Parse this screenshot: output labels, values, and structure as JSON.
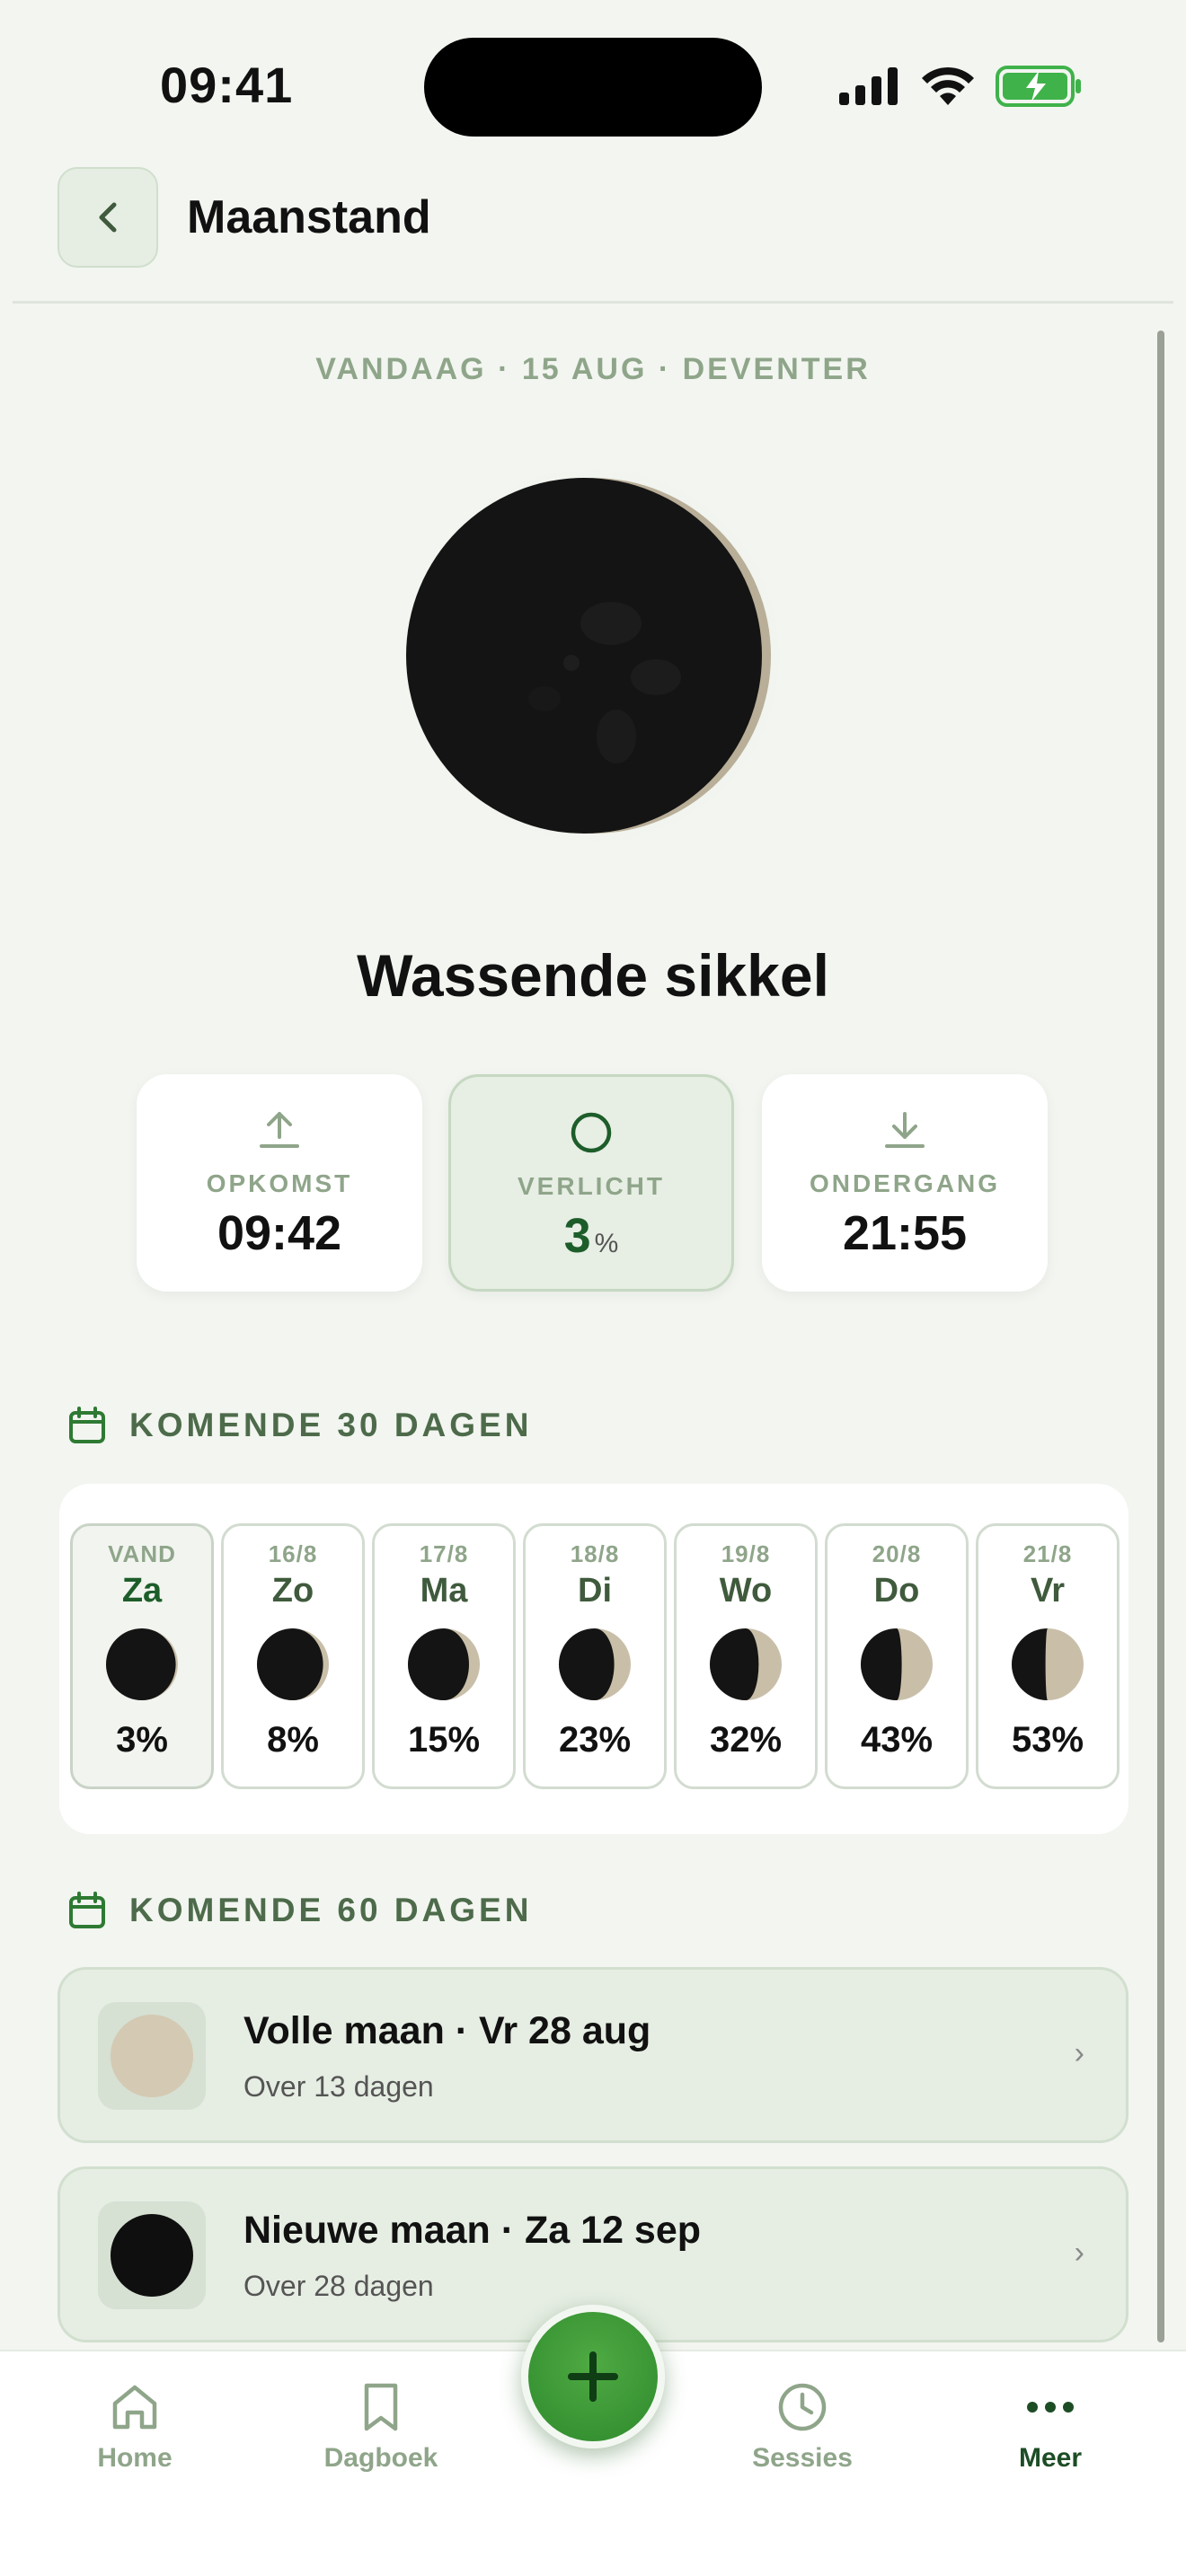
{
  "status_bar": {
    "time": "09:41"
  },
  "header": {
    "title": "Maanstand"
  },
  "today": {
    "date_line": "VANDAAG · 15 AUG · DEVENTER",
    "phase_name": "Wassende sikkel",
    "illumination": 0.03
  },
  "stats": [
    {
      "label": "OPKOMST",
      "value": "09:42",
      "unit": "",
      "icon": "arrow-up-icon"
    },
    {
      "label": "VERLICHT",
      "value": "3",
      "unit": "%",
      "icon": "circle-icon"
    },
    {
      "label": "ONDERGANG",
      "value": "21:55",
      "unit": "",
      "icon": "arrow-down-icon"
    }
  ],
  "sections": {
    "next30": "KOMENDE 30 DAGEN",
    "next60": "KOMENDE 60 DAGEN"
  },
  "days": [
    {
      "date": "VAND",
      "day": "Za",
      "percent": "3%",
      "illum": 0.03
    },
    {
      "date": "16/8",
      "day": "Zo",
      "percent": "8%",
      "illum": 0.08
    },
    {
      "date": "17/8",
      "day": "Ma",
      "percent": "15%",
      "illum": 0.15
    },
    {
      "date": "18/8",
      "day": "Di",
      "percent": "23%",
      "illum": 0.23
    },
    {
      "date": "19/8",
      "day": "Wo",
      "percent": "32%",
      "illum": 0.32
    },
    {
      "date": "20/8",
      "day": "Do",
      "percent": "43%",
      "illum": 0.43
    },
    {
      "date": "21/8",
      "day": "Vr",
      "percent": "53%",
      "illum": 0.53
    }
  ],
  "events": [
    {
      "title": "Volle maan · Vr 28 aug",
      "subtitle": "Over 13 dagen",
      "icon": "full-moon-icon"
    },
    {
      "title": "Nieuwe maan · Za 12 sep",
      "subtitle": "Over 28 dagen",
      "icon": "new-moon-icon"
    }
  ],
  "tabs": [
    {
      "label": "Home",
      "icon": "home-icon"
    },
    {
      "label": "Dagboek",
      "icon": "bookmark-icon"
    },
    {
      "label": "Sessies",
      "icon": "clock-icon"
    },
    {
      "label": "Meer",
      "icon": "more-icon",
      "active": true
    }
  ],
  "colors": {
    "background": "#f2f5f0",
    "accent_green": "#2e8a2c",
    "label_green": "#8fa58a",
    "moon_light": "#c9bfa9",
    "moon_dark": "#141414"
  }
}
